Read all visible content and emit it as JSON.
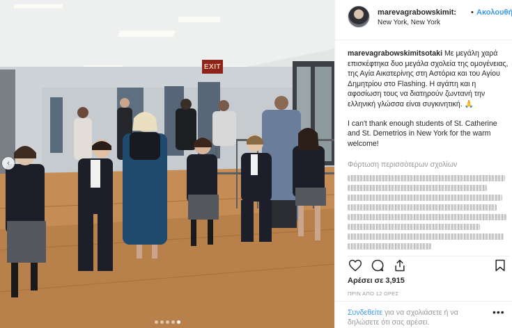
{
  "post": {
    "photo": {
      "exit_sign_text": "EXIT",
      "carousel_dots": 5,
      "active_dot_index": 4,
      "prev_icon": "chevron-left-icon"
    },
    "header": {
      "username": "marevagrabowskimit:",
      "separator": "•",
      "follow_label": "Ακολουθήστε",
      "location": "New York, New York"
    },
    "caption": {
      "username": "marevagrabowskimitsotaki",
      "text_greek": " Με μεγάλη χαρά επισκέφτηκα δυο μεγάλα σχολεία της ομογένειας, της Αγία Αικατερίνης στη Αστόρια και του Αγίου Δημητρίου στο Flashing. Η αγάπη και η αφοσίωση τους να διατηρούν ζωντανή την ελληνική γλώσσα είναι συγκινητική. 🙏",
      "text_english": "I can't thank enough students of St. Catherine and St. Demetrios in New York for the warm welcome!"
    },
    "load_more_comments": "Φόρτωση περισσότερων σχολίων",
    "actions": {
      "like_icon": "heart-icon",
      "comment_icon": "comment-icon",
      "share_icon": "share-icon",
      "save_icon": "bookmark-icon"
    },
    "likes_text": "Αρέσει σε 3,915",
    "timestamp": "ΠΡΙΝ ΑΠΟ 12 ΩΡΕΣ",
    "login": {
      "link": "Συνδεθείτε",
      "rest": " για να σχολιάσετε ή να δηλώσετε ότι σας αρέσει."
    },
    "more_options": "•••",
    "colors": {
      "link_blue": "#3897f0",
      "text": "#262626",
      "muted": "#999999",
      "border": "#efefef"
    }
  }
}
